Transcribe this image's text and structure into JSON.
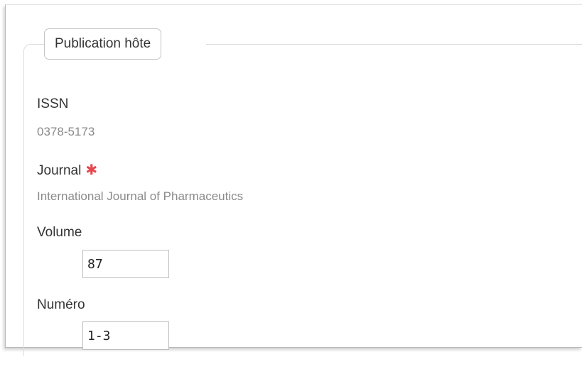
{
  "fieldset": {
    "legend": "Publication hôte"
  },
  "fields": {
    "issn": {
      "label": "ISSN",
      "value": "0378-5173"
    },
    "journal": {
      "label": "Journal",
      "required_marker": "✱",
      "value": "International Journal of Pharmaceutics"
    },
    "volume": {
      "label": "Volume",
      "value": "87"
    },
    "numero": {
      "label": "Numéro",
      "value": "1-3"
    }
  },
  "colors": {
    "required": "#e8454d",
    "label_text": "#333333",
    "value_text": "#8a8a8a"
  }
}
